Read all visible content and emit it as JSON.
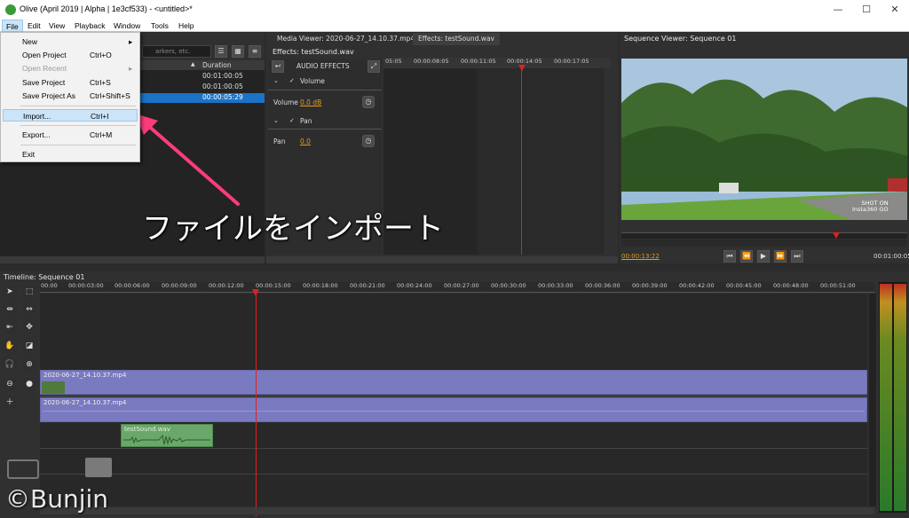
{
  "window": {
    "title": "Olive (April 2019 | Alpha | 1e3cf533) - <untitled>*",
    "minimize": "—",
    "maximize": "☐",
    "close": "✕"
  },
  "menubar": [
    "File",
    "Edit",
    "View",
    "Playback",
    "Window",
    "Tools",
    "Help"
  ],
  "file_menu": [
    {
      "label": "New",
      "shortcut": "",
      "submenu": "▸"
    },
    {
      "label": "Open Project",
      "shortcut": "Ctrl+O"
    },
    {
      "label": "Open Recent",
      "shortcut": "",
      "submenu": "▸",
      "disabled": true
    },
    {
      "label": "Save Project",
      "shortcut": "Ctrl+S"
    },
    {
      "label": "Save Project As",
      "shortcut": "Ctrl+Shift+S"
    },
    {
      "label": "Import...",
      "shortcut": "Ctrl+I",
      "highlighted": true
    },
    {
      "label": "Export...",
      "shortcut": "Ctrl+M"
    },
    {
      "label": "Exit",
      "shortcut": ""
    }
  ],
  "project": {
    "search_placeholder": "arkers, etc.",
    "col_duration": "Duration",
    "rows": [
      "00:01:00:05",
      "00:01:00:05",
      "00:00:05:29"
    ]
  },
  "media_tabs": [
    "Media Viewer: 2020-06-27_14.10.37.mp4",
    "Effects: testSound.wav"
  ],
  "effects": {
    "title": "Effects: testSound.wav",
    "audio_effects": "AUDIO EFFECTS",
    "volume_group": "Volume",
    "volume_label": "Volume",
    "volume_value": "0.0 dB",
    "pan_group": "Pan",
    "pan_label": "Pan",
    "pan_value": "0.0",
    "ruler": [
      "05:05",
      "00:00:08:05",
      "00:00:11:05",
      "00:00:14:05",
      "00:00:17:05"
    ]
  },
  "sequence_viewer": {
    "title": "Sequence Viewer: Sequence 01",
    "timecode": "00:00:13:22",
    "duration": "00:01:00:05",
    "watermark": "SHOT ON\nInsta360 GO"
  },
  "timeline": {
    "title": "Timeline: Sequence 01",
    "ruler": [
      "00:00",
      "00:00:03:00",
      "00:00:06:00",
      "00:00:09:00",
      "00:00:12:00",
      "00:00:15:00",
      "00:00:18:00",
      "00:00:21:00",
      "00:00:24:00",
      "00:00:27:00",
      "00:00:30:00",
      "00:00:33:00",
      "00:00:36:00",
      "00:00:39:00",
      "00:00:42:00",
      "00:00:45:00",
      "00:00:48:00",
      "00:00:51:00"
    ],
    "video_clip": "2020-06-27_14.10.37.mp4",
    "audio_clip": "2020-06-27_14.10.37.mp4",
    "sound_clip": "testSound.wav"
  },
  "annotation": {
    "caption": "ファイルをインポート",
    "color": "#ff3c7a"
  },
  "credit": "©Bunjin"
}
